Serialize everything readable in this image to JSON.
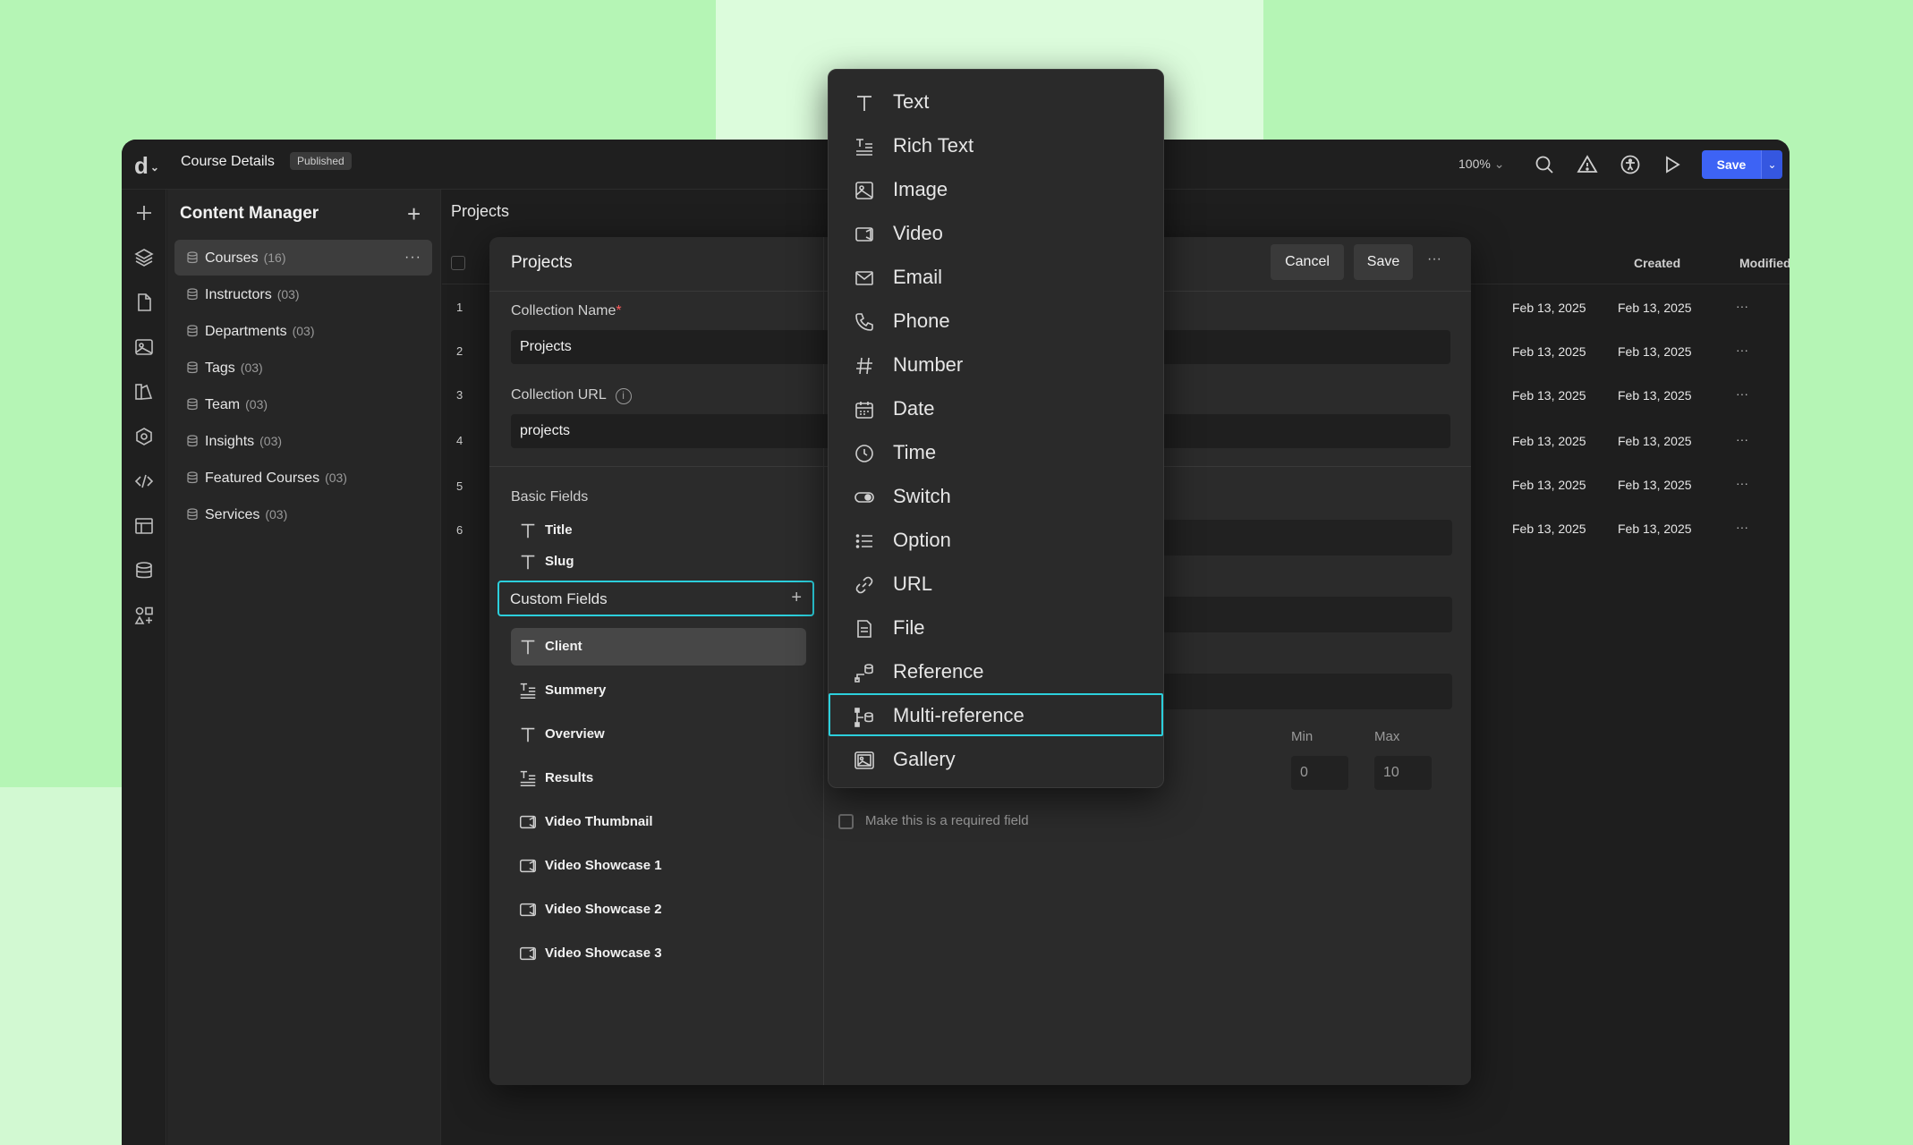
{
  "topbar": {
    "logo": "d",
    "project_name": "Course Details",
    "status_badge": "Published",
    "zoom": "100%",
    "save_label": "Save",
    "accent": "#3d63f5"
  },
  "content_manager": {
    "title": "Content Manager",
    "collections": [
      {
        "label": "Courses",
        "count": "(16)"
      },
      {
        "label": "Instructors",
        "count": "(03)"
      },
      {
        "label": "Departments",
        "count": "(03)"
      },
      {
        "label": "Tags",
        "count": "(03)"
      },
      {
        "label": "Team",
        "count": "(03)"
      },
      {
        "label": "Insights",
        "count": "(03)"
      },
      {
        "label": "Featured Courses",
        "count": "(03)"
      },
      {
        "label": "Services",
        "count": "(03)"
      }
    ]
  },
  "main": {
    "breadcrumb": "Projects",
    "columns": {
      "created": "Created",
      "modified": "Modified"
    },
    "rows": [
      {
        "num": "1",
        "created": "Feb 13, 2025",
        "modified": "Feb 13, 2025"
      },
      {
        "num": "2",
        "created": "Feb 13, 2025",
        "modified": "Feb 13, 2025"
      },
      {
        "num": "3",
        "created": "Feb 13, 2025",
        "modified": "Feb 13, 2025"
      },
      {
        "num": "4",
        "created": "Feb 13, 2025",
        "modified": "Feb 13, 2025"
      },
      {
        "num": "5",
        "created": "Feb 13, 2025",
        "modified": "Feb 13, 2025"
      },
      {
        "num": "6",
        "created": "Feb 13, 2025",
        "modified": "Feb 13, 2025"
      }
    ]
  },
  "modal": {
    "title": "Projects",
    "cancel_label": "Cancel",
    "save_label": "Save",
    "collection_name_label": "Collection Name",
    "required_mark": "*",
    "collection_name_value": "Projects",
    "collection_url_label": "Collection URL",
    "collection_url_value": "projects",
    "basic_fields_label": "Basic Fields",
    "basic_fields": [
      "Title",
      "Slug"
    ],
    "custom_fields_label": "Custom Fields",
    "custom_fields": [
      {
        "label": "Client",
        "icon": "text-icon"
      },
      {
        "label": "Summery",
        "icon": "rich-text-icon"
      },
      {
        "label": "Overview",
        "icon": "text-icon"
      },
      {
        "label": "Results",
        "icon": "rich-text-icon"
      },
      {
        "label": "Video Thumbnail",
        "icon": "video-icon"
      },
      {
        "label": "Video Showcase 1",
        "icon": "video-icon"
      },
      {
        "label": "Video Showcase 2",
        "icon": "video-icon"
      },
      {
        "label": "Video Showcase 3",
        "icon": "video-icon"
      }
    ],
    "min_label": "Min",
    "max_label": "Max",
    "min_value": "0",
    "max_value": "10",
    "required_checkbox_label": "Make this is a required field"
  },
  "field_type_menu": {
    "highlight_color": "#2ccfdc",
    "items": [
      {
        "label": "Text",
        "icon": "text-icon"
      },
      {
        "label": "Rich Text",
        "icon": "rich-text-icon"
      },
      {
        "label": "Image",
        "icon": "image-icon"
      },
      {
        "label": "Video",
        "icon": "video-icon"
      },
      {
        "label": "Email",
        "icon": "email-icon"
      },
      {
        "label": "Phone",
        "icon": "phone-icon"
      },
      {
        "label": "Number",
        "icon": "hash-icon"
      },
      {
        "label": "Date",
        "icon": "calendar-icon"
      },
      {
        "label": "Time",
        "icon": "clock-icon"
      },
      {
        "label": "Switch",
        "icon": "toggle-icon"
      },
      {
        "label": "Option",
        "icon": "list-icon"
      },
      {
        "label": "URL",
        "icon": "link-icon"
      },
      {
        "label": "File",
        "icon": "file-icon"
      },
      {
        "label": "Reference",
        "icon": "reference-icon"
      },
      {
        "label": "Multi-reference",
        "icon": "multi-reference-icon"
      },
      {
        "label": "Gallery",
        "icon": "gallery-icon"
      }
    ]
  }
}
